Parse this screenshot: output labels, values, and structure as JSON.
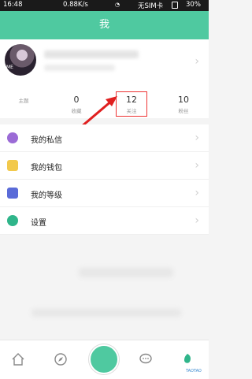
{
  "status_bar": {
    "time": "16:48",
    "speed": "0.88K/s",
    "sim": "无SIM卡",
    "battery": "30%"
  },
  "header": {
    "title": "我"
  },
  "profile": {
    "avatar_caption": "ME",
    "stats": [
      {
        "value": "",
        "label": "主题"
      },
      {
        "value": "0",
        "label": "收藏"
      },
      {
        "value": "12",
        "label": "关注"
      },
      {
        "value": "10",
        "label": "粉丝"
      }
    ]
  },
  "menu": [
    {
      "label": "我的私信",
      "icon": "message-icon",
      "color": "#9b6bd6"
    },
    {
      "label": "我的钱包",
      "icon": "wallet-icon",
      "color": "#f2c94c"
    },
    {
      "label": "我的等级",
      "icon": "level-icon",
      "color": "#5a6bd8"
    },
    {
      "label": "设置",
      "icon": "settings-icon",
      "color": "#2fb58a"
    }
  ],
  "bottom_nav": {
    "items": [
      "home-icon",
      "discover-icon",
      "publish-button",
      "chat-icon",
      "me-icon"
    ],
    "watermark": "TAOTAO"
  },
  "colors": {
    "accent": "#4fc9a0",
    "highlight": "#ee3333"
  }
}
